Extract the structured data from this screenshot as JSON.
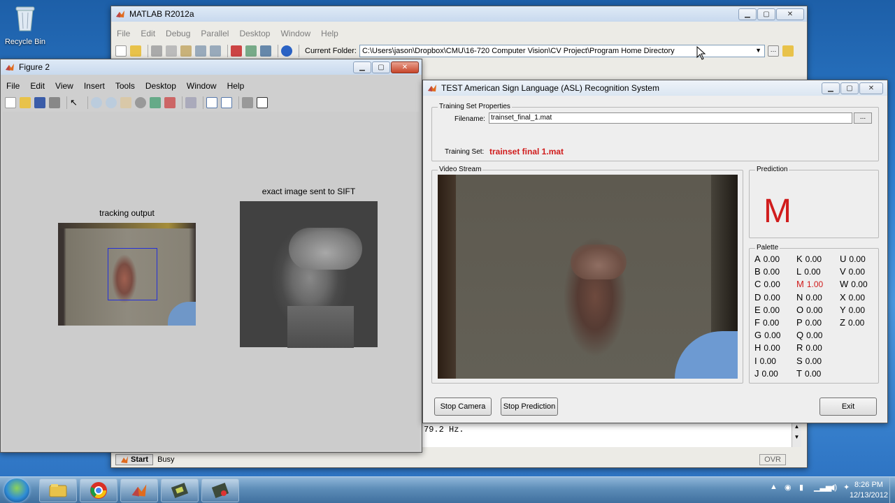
{
  "desktop": {
    "recycle_bin_label": "Recycle Bin"
  },
  "matlab": {
    "title": "MATLAB  R2012a",
    "menu": [
      "File",
      "Edit",
      "Debug",
      "Parallel",
      "Desktop",
      "Window",
      "Help"
    ],
    "current_folder_label": "Current Folder:",
    "current_folder_value": "C:\\Users\\jason\\Dropbox\\CMU\\16-720 Computer Vision\\CV Project\\Program Home Directory",
    "start_label": "Start",
    "status": "Busy",
    "ovr": "OVR",
    "command_output": "79.2 Hz."
  },
  "figure2": {
    "title": "Figure 2",
    "menu": [
      "File",
      "Edit",
      "View",
      "Insert",
      "Tools",
      "Desktop",
      "Window",
      "Help"
    ],
    "tracking_title": "tracking output",
    "sift_title": "exact image sent to SIFT"
  },
  "asl": {
    "title": "TEST American Sign Language (ASL) Recognition System",
    "training_group": "Training Set Properties",
    "filename_label": "Filename:",
    "filename_value": "trainset_final_1.mat",
    "browse_label": "...",
    "training_set_label": "Training Set:",
    "training_set_value": "trainset  final  1.mat",
    "video_group": "Video Stream",
    "prediction_group": "Prediction",
    "prediction_value": "M",
    "palette_group": "Palette",
    "palette": [
      [
        {
          "l": "A",
          "v": "0.00"
        },
        {
          "l": "B",
          "v": "0.00"
        },
        {
          "l": "C",
          "v": "0.00"
        },
        {
          "l": "D",
          "v": "0.00"
        },
        {
          "l": "E",
          "v": "0.00"
        },
        {
          "l": "F",
          "v": "0.00"
        },
        {
          "l": "G",
          "v": "0.00"
        },
        {
          "l": "H",
          "v": "0.00"
        },
        {
          "l": "I",
          "v": "0.00"
        },
        {
          "l": "J",
          "v": "0.00"
        }
      ],
      [
        {
          "l": "K",
          "v": "0.00"
        },
        {
          "l": "L",
          "v": "0.00"
        },
        {
          "l": "M",
          "v": "1.00"
        },
        {
          "l": "N",
          "v": "0.00"
        },
        {
          "l": "O",
          "v": "0.00"
        },
        {
          "l": "P",
          "v": "0.00"
        },
        {
          "l": "Q",
          "v": "0.00"
        },
        {
          "l": "R",
          "v": "0.00"
        },
        {
          "l": "S",
          "v": "0.00"
        },
        {
          "l": "T",
          "v": "0.00"
        }
      ],
      [
        {
          "l": "U",
          "v": "0.00"
        },
        {
          "l": "V",
          "v": "0.00"
        },
        {
          "l": "W",
          "v": "0.00"
        },
        {
          "l": "X",
          "v": "0.00"
        },
        {
          "l": "Y",
          "v": "0.00"
        },
        {
          "l": "Z",
          "v": "0.00"
        }
      ]
    ],
    "highlight_letter": "M",
    "stop_camera": "Stop Camera",
    "stop_prediction": "Stop Prediction",
    "exit": "Exit",
    "accent": "#d01c1c"
  },
  "taskbar": {
    "apps": [
      "file-explorer-icon",
      "chrome-icon",
      "matlab-icon",
      "figure-app-icon",
      "asl-app-icon"
    ],
    "time": "8:26 PM",
    "date": "12/13/2012"
  }
}
